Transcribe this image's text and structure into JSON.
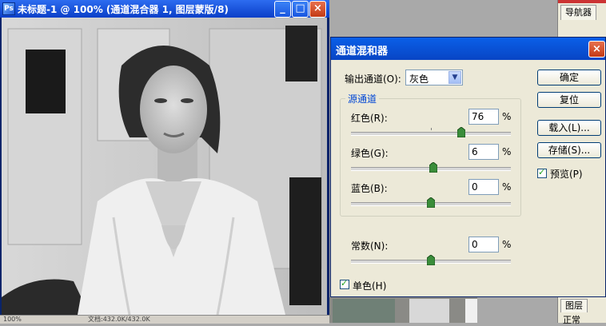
{
  "document": {
    "title": "未标题-1 @ 100% (通道混合器 1, 图层蒙版/8)",
    "status_zoom": "100%",
    "status_doc": "文档:432.0K/432.0K"
  },
  "window_buttons": {
    "minimize": "_",
    "maximize": "□",
    "close": "×"
  },
  "navigator_palette": {
    "tab": "导航器"
  },
  "layers_palette": {
    "tab": "图层",
    "blend_mode": "正常"
  },
  "dialog": {
    "title": "通道混和器",
    "output_channel_label": "输出通道(O):",
    "output_channel_value": "灰色",
    "source_group_label": "源通道",
    "pct": "%",
    "sliders": {
      "red": {
        "label": "红色(R):",
        "value": "76",
        "position": 76
      },
      "green": {
        "label": "绿色(G):",
        "value": "6",
        "position": 6
      },
      "blue": {
        "label": "蓝色(B):",
        "value": "0",
        "position": 0
      },
      "constant": {
        "label": "常数(N):",
        "value": "0",
        "position": 0
      }
    },
    "monochrome_label": "单色(H)",
    "buttons": {
      "ok": "确定",
      "reset": "复位",
      "load": "载入(L)...",
      "save": "存储(S)..."
    },
    "preview_label": "预览(P)"
  }
}
